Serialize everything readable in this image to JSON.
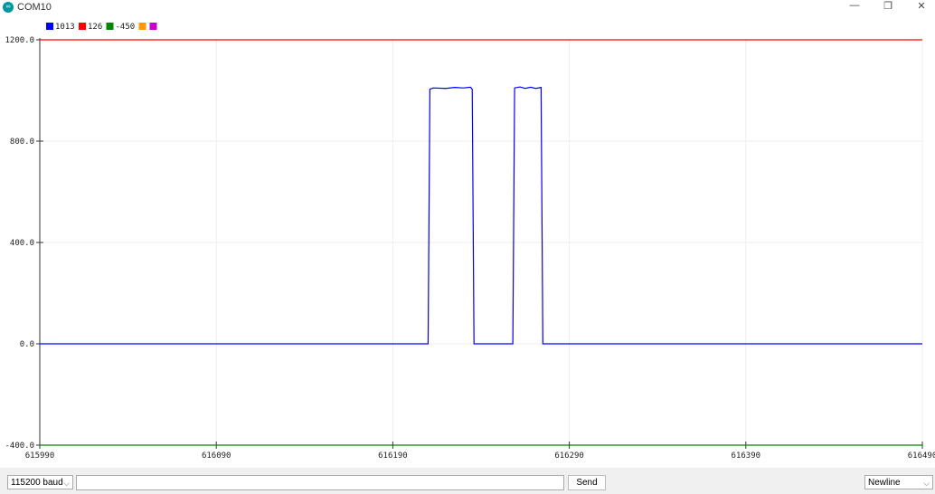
{
  "window": {
    "title": "COM10",
    "logo": "∞",
    "minimize": "—",
    "restore": "❐",
    "close": "✕"
  },
  "legend": [
    {
      "label": "1013",
      "color": "#0000ff"
    },
    {
      "label": "126",
      "color": "#ff0000"
    },
    {
      "label": "-450",
      "color": "#008800"
    },
    {
      "label": "",
      "color": "#ff9900"
    },
    {
      "label": "",
      "color": "#cc00cc"
    }
  ],
  "chart_data": {
    "type": "line",
    "xlim": [
      615990,
      616490
    ],
    "ylim": [
      -400,
      1200
    ],
    "xticks": [
      "615990",
      "616090",
      "616190",
      "616290",
      "616390",
      "616490"
    ],
    "yticks": [
      "-400.0",
      "0.0",
      "400.0",
      "800.0",
      "1200.0"
    ],
    "grid": true,
    "series": [
      {
        "name": "1013",
        "color": "#0000ff",
        "x": [
          615990,
          616210,
          616211,
          616213,
          616220,
          616225,
          616230,
          616234,
          616235,
          616236,
          616258,
          616259,
          616262,
          616265,
          616268,
          616271,
          616274,
          616275,
          616490
        ],
        "y": [
          0,
          0,
          1005,
          1010,
          1008,
          1012,
          1010,
          1013,
          1005,
          0,
          0,
          1010,
          1014,
          1008,
          1013,
          1008,
          1012,
          0,
          0
        ]
      },
      {
        "name": "126",
        "color": "#ff0000",
        "x": [
          615990,
          616490
        ],
        "y": [
          1200,
          1200
        ]
      },
      {
        "name": "-450",
        "color": "#008800",
        "x": [
          615990,
          616490
        ],
        "y": [
          -400,
          -400
        ]
      }
    ]
  },
  "bottom": {
    "baud": "115200 baud",
    "input_value": "",
    "send": "Send",
    "line_ending": "Newline"
  }
}
